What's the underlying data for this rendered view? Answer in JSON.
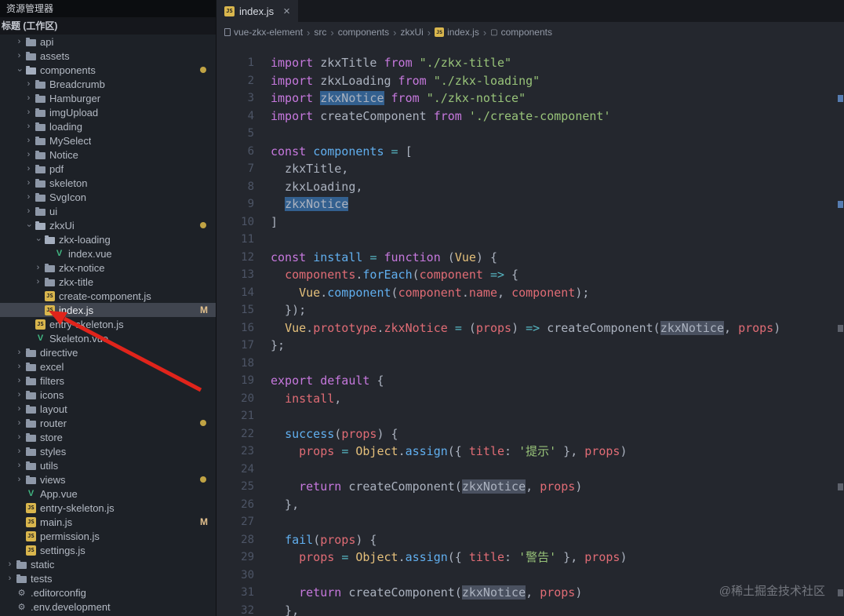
{
  "icons": {
    "js_glyph": "JS",
    "vue_glyph": "V",
    "gear_glyph": "⚙",
    "chevron_glyph": "›",
    "symbol_glyph": "▢",
    "close_glyph": "×"
  },
  "sidebar": {
    "explorer_title": "资源管理器",
    "workspace_header": "标题 (工作区)",
    "tree": [
      {
        "label": "api",
        "depth": 1,
        "chevron": "right",
        "icon": "folder"
      },
      {
        "label": "assets",
        "depth": 1,
        "chevron": "right",
        "icon": "folder"
      },
      {
        "label": "components",
        "depth": 1,
        "chevron": "down",
        "icon": "folder-open",
        "dot": true
      },
      {
        "label": "Breadcrumb",
        "depth": 2,
        "chevron": "right",
        "icon": "folder"
      },
      {
        "label": "Hamburger",
        "depth": 2,
        "chevron": "right",
        "icon": "folder"
      },
      {
        "label": "imgUpload",
        "depth": 2,
        "chevron": "right",
        "icon": "folder"
      },
      {
        "label": "loading",
        "depth": 2,
        "chevron": "right",
        "icon": "folder"
      },
      {
        "label": "MySelect",
        "depth": 2,
        "chevron": "right",
        "icon": "folder"
      },
      {
        "label": "Notice",
        "depth": 2,
        "chevron": "right",
        "icon": "folder"
      },
      {
        "label": "pdf",
        "depth": 2,
        "chevron": "right",
        "icon": "folder"
      },
      {
        "label": "skeleton",
        "depth": 2,
        "chevron": "right",
        "icon": "folder"
      },
      {
        "label": "SvgIcon",
        "depth": 2,
        "chevron": "right",
        "icon": "folder"
      },
      {
        "label": "ui",
        "depth": 2,
        "chevron": "right",
        "icon": "folder"
      },
      {
        "label": "zkxUi",
        "depth": 2,
        "chevron": "down",
        "icon": "folder-open",
        "dot": true
      },
      {
        "label": "zkx-loading",
        "depth": 3,
        "chevron": "down",
        "icon": "folder-open"
      },
      {
        "label": "index.vue",
        "depth": 4,
        "icon": "vue"
      },
      {
        "label": "zkx-notice",
        "depth": 3,
        "chevron": "right",
        "icon": "folder"
      },
      {
        "label": "zkx-title",
        "depth": 3,
        "chevron": "right",
        "icon": "folder"
      },
      {
        "label": "create-component.js",
        "depth": 3,
        "icon": "js"
      },
      {
        "label": "index.js",
        "depth": 3,
        "icon": "js",
        "selected": true,
        "badge": "M"
      },
      {
        "label": "entry-skeleton.js",
        "depth": 2,
        "icon": "js"
      },
      {
        "label": "Skeleton.vue",
        "depth": 2,
        "icon": "vue"
      },
      {
        "label": "directive",
        "depth": 1,
        "chevron": "right",
        "icon": "folder"
      },
      {
        "label": "excel",
        "depth": 1,
        "chevron": "right",
        "icon": "folder"
      },
      {
        "label": "filters",
        "depth": 1,
        "chevron": "right",
        "icon": "folder"
      },
      {
        "label": "icons",
        "depth": 1,
        "chevron": "right",
        "icon": "folder"
      },
      {
        "label": "layout",
        "depth": 1,
        "chevron": "right",
        "icon": "folder"
      },
      {
        "label": "router",
        "depth": 1,
        "chevron": "right",
        "icon": "folder",
        "dot": true
      },
      {
        "label": "store",
        "depth": 1,
        "chevron": "right",
        "icon": "folder"
      },
      {
        "label": "styles",
        "depth": 1,
        "chevron": "right",
        "icon": "folder"
      },
      {
        "label": "utils",
        "depth": 1,
        "chevron": "right",
        "icon": "folder"
      },
      {
        "label": "views",
        "depth": 1,
        "chevron": "right",
        "icon": "folder",
        "dot": true
      },
      {
        "label": "App.vue",
        "depth": 1,
        "icon": "vue"
      },
      {
        "label": "entry-skeleton.js",
        "depth": 1,
        "icon": "js"
      },
      {
        "label": "main.js",
        "depth": 1,
        "icon": "js",
        "badge": "M"
      },
      {
        "label": "permission.js",
        "depth": 1,
        "icon": "js"
      },
      {
        "label": "settings.js",
        "depth": 1,
        "icon": "js"
      },
      {
        "label": "static",
        "depth": 0,
        "chevron": "right",
        "icon": "folder"
      },
      {
        "label": "tests",
        "depth": 0,
        "chevron": "right",
        "icon": "folder"
      },
      {
        "label": ".editorconfig",
        "depth": 0,
        "icon": "gear"
      },
      {
        "label": ".env.development",
        "depth": 0,
        "icon": "gear"
      }
    ]
  },
  "tabbar": {
    "tabs": [
      {
        "label": "index.js",
        "icon": "js",
        "active": true
      }
    ]
  },
  "breadcrumb": {
    "separator": "›",
    "items": [
      {
        "label": "vue-zkx-element",
        "icon": "file"
      },
      {
        "label": "src"
      },
      {
        "label": "components"
      },
      {
        "label": "zkxUi"
      },
      {
        "label": "index.js",
        "icon": "js"
      },
      {
        "label": "components",
        "icon": "symbol"
      }
    ]
  },
  "editor": {
    "language": "javascript",
    "lines": [
      {
        "n": 1,
        "t": [
          [
            "k",
            "import "
          ],
          [
            "p",
            "zkxTitle"
          ],
          [
            "k",
            " from "
          ],
          [
            "s",
            "\"./zkx-title\""
          ]
        ]
      },
      {
        "n": 2,
        "t": [
          [
            "k",
            "import "
          ],
          [
            "p",
            "zkxLoading"
          ],
          [
            "k",
            " from "
          ],
          [
            "s",
            "\"./zkx-loading\""
          ]
        ]
      },
      {
        "n": 3,
        "t": [
          [
            "k",
            "import "
          ],
          [
            "p hl1",
            "zkxNotice"
          ],
          [
            "k",
            " from "
          ],
          [
            "s",
            "\"./zkx-notice\""
          ]
        ]
      },
      {
        "n": 4,
        "t": [
          [
            "k",
            "import "
          ],
          [
            "p",
            "createComponent"
          ],
          [
            "k",
            " from "
          ],
          [
            "s",
            "'./create-component'"
          ]
        ]
      },
      {
        "n": 5,
        "t": []
      },
      {
        "n": 6,
        "t": [
          [
            "k",
            "const "
          ],
          [
            "f",
            "components"
          ],
          [
            "p",
            " "
          ],
          [
            "c",
            "="
          ],
          [
            "p",
            " ["
          ]
        ]
      },
      {
        "n": 7,
        "t": [
          [
            "p",
            "  zkxTitle,"
          ]
        ]
      },
      {
        "n": 8,
        "t": [
          [
            "p",
            "  zkxLoading,"
          ]
        ]
      },
      {
        "n": 9,
        "t": [
          [
            "p",
            "  "
          ],
          [
            "p hl1",
            "zkxNotice"
          ]
        ]
      },
      {
        "n": 10,
        "t": [
          [
            "p",
            "]"
          ]
        ]
      },
      {
        "n": 11,
        "t": []
      },
      {
        "n": 12,
        "t": [
          [
            "k",
            "const "
          ],
          [
            "f",
            "install"
          ],
          [
            "p",
            " "
          ],
          [
            "c",
            "="
          ],
          [
            "p",
            " "
          ],
          [
            "k",
            "function"
          ],
          [
            "p",
            " ("
          ],
          [
            "y",
            "Vue"
          ],
          [
            "p",
            ") {"
          ]
        ]
      },
      {
        "n": 13,
        "t": [
          [
            "p",
            "  "
          ],
          [
            "r",
            "components"
          ],
          [
            "p",
            "."
          ],
          [
            "f",
            "forEach"
          ],
          [
            "p",
            "("
          ],
          [
            "r",
            "component"
          ],
          [
            "p",
            " "
          ],
          [
            "c",
            "=>"
          ],
          [
            "p",
            " {"
          ]
        ]
      },
      {
        "n": 14,
        "t": [
          [
            "p",
            "    "
          ],
          [
            "y",
            "Vue"
          ],
          [
            "p",
            "."
          ],
          [
            "f",
            "component"
          ],
          [
            "p",
            "("
          ],
          [
            "r",
            "component"
          ],
          [
            "p",
            "."
          ],
          [
            "r",
            "name"
          ],
          [
            "p",
            ", "
          ],
          [
            "r",
            "component"
          ],
          [
            "p",
            ");"
          ]
        ]
      },
      {
        "n": 15,
        "t": [
          [
            "p",
            "  });"
          ]
        ]
      },
      {
        "n": 16,
        "t": [
          [
            "p",
            "  "
          ],
          [
            "y",
            "Vue"
          ],
          [
            "p",
            "."
          ],
          [
            "r",
            "prototype"
          ],
          [
            "p",
            "."
          ],
          [
            "r",
            "zkxNotice"
          ],
          [
            "p",
            " "
          ],
          [
            "c",
            "="
          ],
          [
            "p",
            " ("
          ],
          [
            "r",
            "props"
          ],
          [
            "p",
            ") "
          ],
          [
            "c",
            "=>"
          ],
          [
            "p",
            " createComponent("
          ],
          [
            "p hl2",
            "zkxNotice"
          ],
          [
            "p",
            ", "
          ],
          [
            "r",
            "props"
          ],
          [
            "p",
            ")"
          ]
        ]
      },
      {
        "n": 17,
        "t": [
          [
            "p",
            "};"
          ]
        ]
      },
      {
        "n": 18,
        "t": []
      },
      {
        "n": 19,
        "t": [
          [
            "k",
            "export default"
          ],
          [
            "p",
            " {"
          ]
        ]
      },
      {
        "n": 20,
        "t": [
          [
            "p",
            "  "
          ],
          [
            "r",
            "install"
          ],
          [
            "p",
            ","
          ]
        ]
      },
      {
        "n": 21,
        "t": []
      },
      {
        "n": 22,
        "t": [
          [
            "p",
            "  "
          ],
          [
            "f",
            "success"
          ],
          [
            "p",
            "("
          ],
          [
            "r",
            "props"
          ],
          [
            "p",
            ") {"
          ]
        ]
      },
      {
        "n": 23,
        "t": [
          [
            "p",
            "    "
          ],
          [
            "r",
            "props"
          ],
          [
            "p",
            " "
          ],
          [
            "c",
            "="
          ],
          [
            "p",
            " "
          ],
          [
            "y",
            "Object"
          ],
          [
            "p",
            "."
          ],
          [
            "f",
            "assign"
          ],
          [
            "p",
            "({ "
          ],
          [
            "r",
            "title"
          ],
          [
            "p",
            ": "
          ],
          [
            "s",
            "'提示'"
          ],
          [
            "p",
            " }, "
          ],
          [
            "r",
            "props"
          ],
          [
            "p",
            ")"
          ]
        ]
      },
      {
        "n": 24,
        "t": []
      },
      {
        "n": 25,
        "t": [
          [
            "p",
            "    "
          ],
          [
            "k",
            "return"
          ],
          [
            "p",
            " createComponent("
          ],
          [
            "p hl2",
            "zkxNotice"
          ],
          [
            "p",
            ", "
          ],
          [
            "r",
            "props"
          ],
          [
            "p",
            ")"
          ]
        ]
      },
      {
        "n": 26,
        "t": [
          [
            "p",
            "  },"
          ]
        ]
      },
      {
        "n": 27,
        "t": []
      },
      {
        "n": 28,
        "t": [
          [
            "p",
            "  "
          ],
          [
            "f",
            "fail"
          ],
          [
            "p",
            "("
          ],
          [
            "r",
            "props"
          ],
          [
            "p",
            ") {"
          ]
        ]
      },
      {
        "n": 29,
        "t": [
          [
            "p",
            "    "
          ],
          [
            "r",
            "props"
          ],
          [
            "p",
            " "
          ],
          [
            "c",
            "="
          ],
          [
            "p",
            " "
          ],
          [
            "y",
            "Object"
          ],
          [
            "p",
            "."
          ],
          [
            "f",
            "assign"
          ],
          [
            "p",
            "({ "
          ],
          [
            "r",
            "title"
          ],
          [
            "p",
            ": "
          ],
          [
            "s",
            "'警告'"
          ],
          [
            "p",
            " }, "
          ],
          [
            "r",
            "props"
          ],
          [
            "p",
            ")"
          ]
        ]
      },
      {
        "n": 30,
        "t": []
      },
      {
        "n": 31,
        "t": [
          [
            "p",
            "    "
          ],
          [
            "k",
            "return"
          ],
          [
            "p",
            " createComponent("
          ],
          [
            "p hl2",
            "zkxNotice"
          ],
          [
            "p",
            ", "
          ],
          [
            "r",
            "props"
          ],
          [
            "p",
            ")"
          ]
        ]
      },
      {
        "n": 32,
        "t": [
          [
            "p",
            "  },"
          ]
        ]
      }
    ],
    "ruler_marks": [
      {
        "line": 3,
        "style": "blue"
      },
      {
        "line": 9,
        "style": "blue"
      },
      {
        "line": 16,
        "style": "gray"
      },
      {
        "line": 25,
        "style": "gray"
      },
      {
        "line": 31,
        "style": "gray"
      }
    ]
  },
  "annotation": {
    "arrow_color": "#e0241b"
  },
  "watermark": "@稀土掘金技术社区"
}
